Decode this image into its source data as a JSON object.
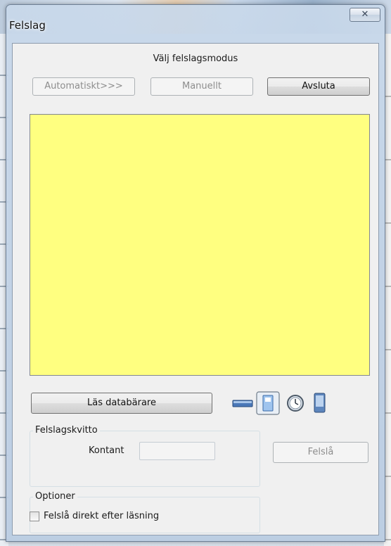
{
  "window": {
    "title": "Felslag",
    "close_glyph": "✕"
  },
  "mode": {
    "heading": "Välj felslagsmodus",
    "automatic_label": "Automatiskt>>>",
    "manual_label": "Manuellt",
    "exit_label": "Avsluta"
  },
  "panel": {
    "background_color": "#ffff80"
  },
  "reader": {
    "read_label": "Läs databärare",
    "icons": [
      "card-slot-icon",
      "card-reader-icon",
      "clock-icon",
      "mobile-phone-icon"
    ]
  },
  "receipt_group": {
    "title": "Felslagskvitto",
    "cash_label": "Kontant",
    "cash_value": "",
    "action_label": "Felslå"
  },
  "options_group": {
    "title": "Optioner",
    "direct_label": "Felslå direkt efter läsning",
    "direct_checked": false
  }
}
